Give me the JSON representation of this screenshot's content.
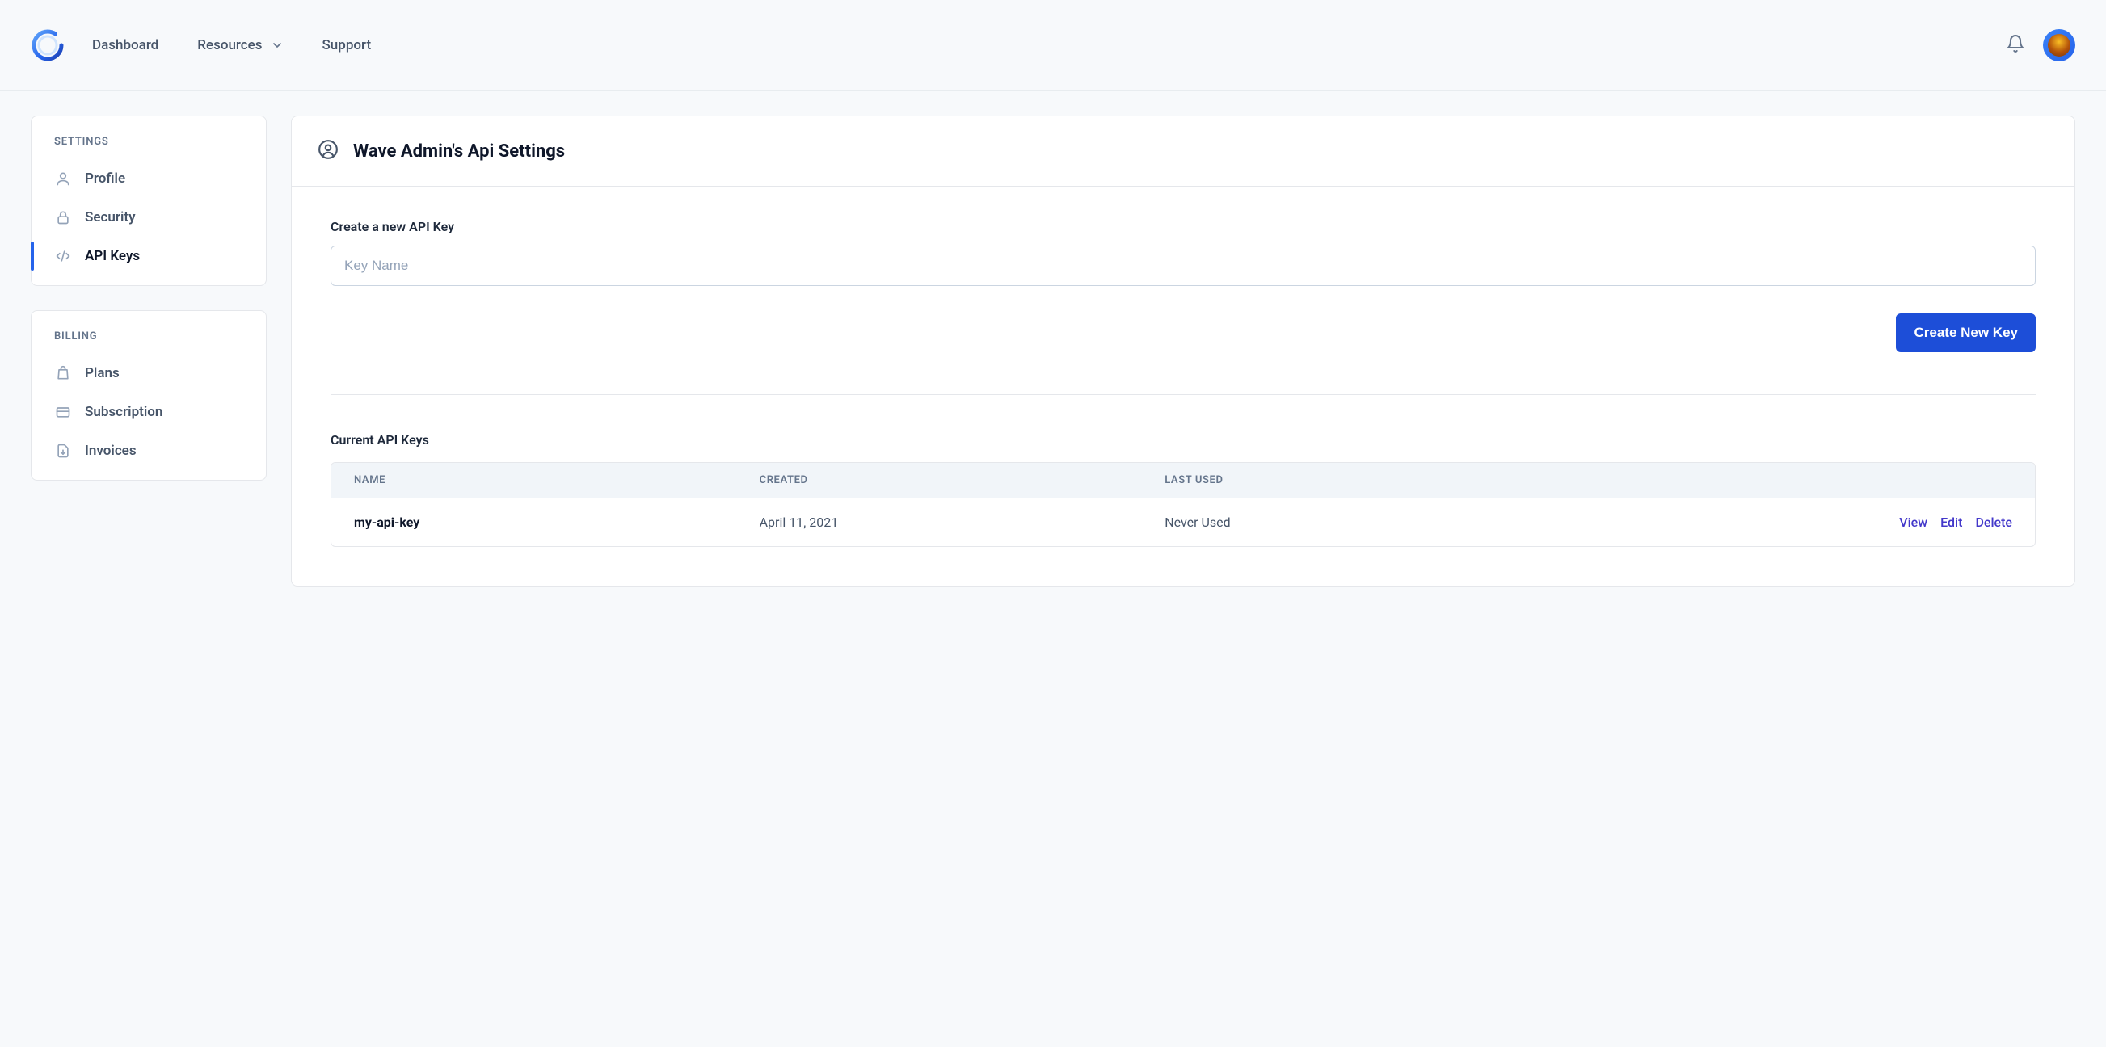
{
  "nav": {
    "dashboard": "Dashboard",
    "resources": "Resources",
    "support": "Support"
  },
  "sidebar": {
    "settings_title": "SETTINGS",
    "billing_title": "BILLING",
    "settings_items": [
      {
        "label": "Profile"
      },
      {
        "label": "Security"
      },
      {
        "label": "API Keys"
      }
    ],
    "billing_items": [
      {
        "label": "Plans"
      },
      {
        "label": "Subscription"
      },
      {
        "label": "Invoices"
      }
    ]
  },
  "main": {
    "title": "Wave Admin's Api Settings",
    "create_label": "Create a new API Key",
    "key_placeholder": "Key Name",
    "create_button": "Create New Key",
    "current_label": "Current API Keys",
    "columns": {
      "name": "NAME",
      "created": "CREATED",
      "last_used": "LAST USED"
    },
    "keys": [
      {
        "name": "my-api-key",
        "created": "April 11, 2021",
        "last_used": "Never Used"
      }
    ],
    "actions": {
      "view": "View",
      "edit": "Edit",
      "delete": "Delete"
    }
  }
}
